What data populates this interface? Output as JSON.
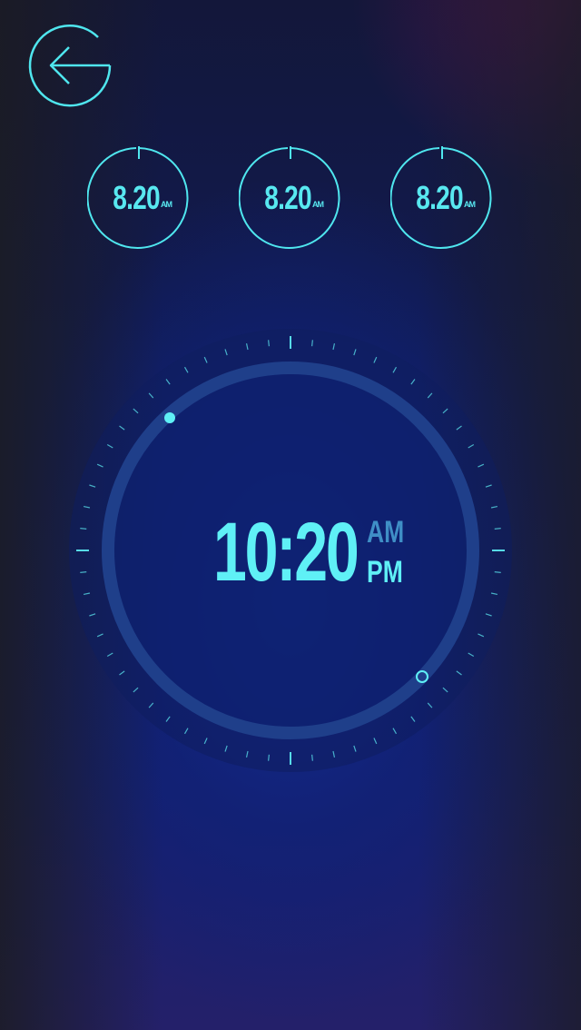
{
  "header": {
    "back_icon": "arrow-left-icon"
  },
  "alarms": [
    {
      "time": "8.20",
      "ampm": "AM"
    },
    {
      "time": "8.20",
      "ampm": "AM"
    },
    {
      "time": "8.20",
      "ampm": "AM"
    }
  ],
  "clock": {
    "time": "10:20",
    "am_label": "AM",
    "pm_label": "PM",
    "selected_period": "PM"
  },
  "colors": {
    "accent": "#5ff0f6",
    "accent_dim": "#3f8fc6",
    "ring": "#1f3f8a"
  }
}
